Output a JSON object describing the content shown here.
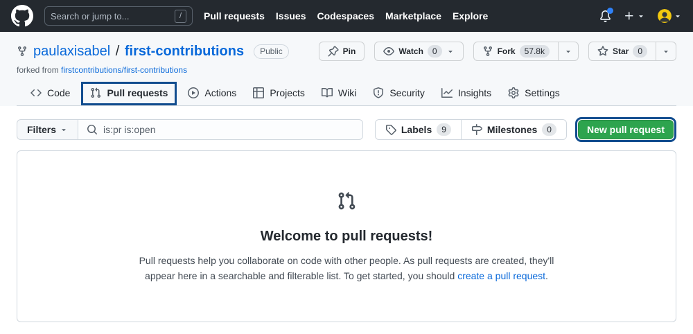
{
  "header": {
    "search_placeholder": "Search or jump to...",
    "search_shortcut": "/",
    "nav": [
      "Pull requests",
      "Issues",
      "Codespaces",
      "Marketplace",
      "Explore"
    ]
  },
  "repo": {
    "owner": "paulaxisabel",
    "separator": "/",
    "name": "first-contributions",
    "visibility": "Public",
    "forked_from_label": "forked from",
    "forked_from_link": "firstcontributions/first-contributions",
    "actions": {
      "pin_label": "Pin",
      "watch_label": "Watch",
      "watch_count": "0",
      "fork_label": "Fork",
      "fork_count": "57.8k",
      "star_label": "Star",
      "star_count": "0"
    }
  },
  "tabs": [
    {
      "label": "Code"
    },
    {
      "label": "Pull requests"
    },
    {
      "label": "Actions"
    },
    {
      "label": "Projects"
    },
    {
      "label": "Wiki"
    },
    {
      "label": "Security"
    },
    {
      "label": "Insights"
    },
    {
      "label": "Settings"
    }
  ],
  "filter_bar": {
    "filters_label": "Filters",
    "search_value": "is:pr is:open",
    "labels_label": "Labels",
    "labels_count": "9",
    "milestones_label": "Milestones",
    "milestones_count": "0",
    "new_pr_label": "New pull request"
  },
  "empty_state": {
    "title": "Welcome to pull requests!",
    "description_part1": "Pull requests help you collaborate on code with other people. As pull requests are created, they'll appear here in a searchable and filterable list. To get started, you should ",
    "link_text": "create a pull request",
    "description_part2": "."
  },
  "colors": {
    "header_bg": "#24292f",
    "link_blue": "#0969da",
    "button_green": "#2da44e",
    "annotation_blue": "#124d8f",
    "notification_dot": "#2f81f7",
    "hero_bg": "#f6f8fa",
    "border_gray": "#d0d7de"
  }
}
